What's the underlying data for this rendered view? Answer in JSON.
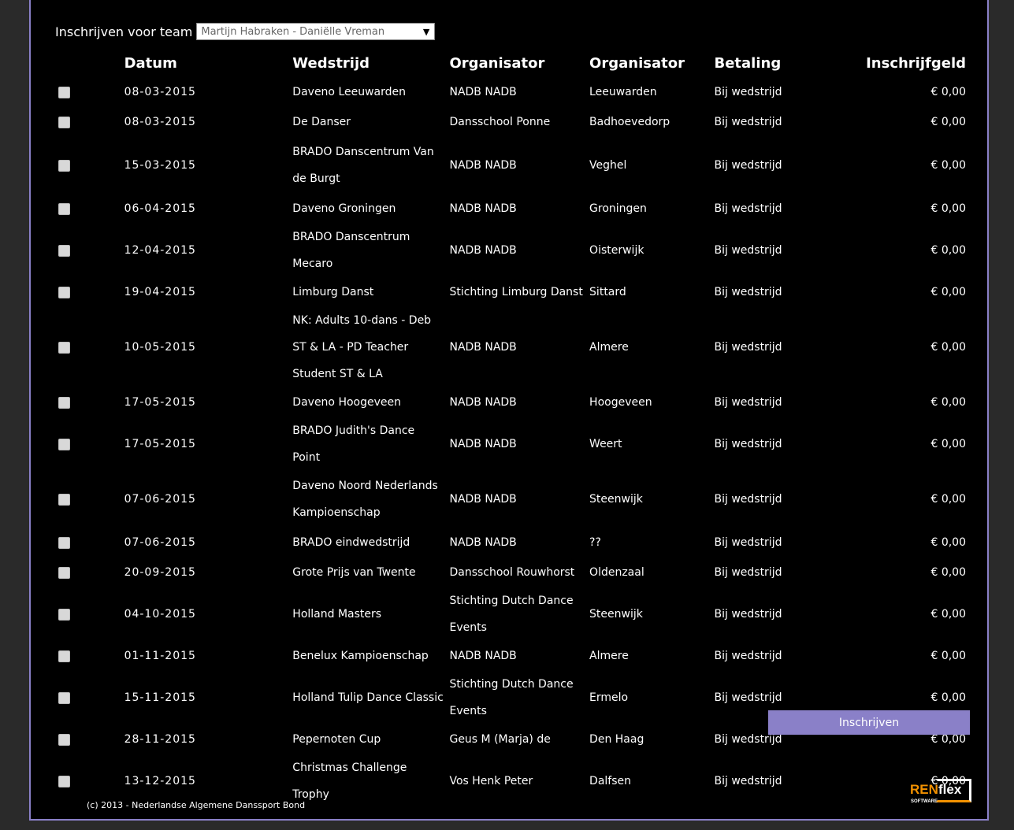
{
  "team": {
    "label": "Inschrijven voor team",
    "selected": "Martijn Habraken - Daniëlle Vreman",
    "arrow": "▼"
  },
  "table": {
    "headers": {
      "datum": "Datum",
      "wedstrijd": "Wedstrijd",
      "organisator": "Organisator",
      "plaats": "Organisator",
      "betaling": "Betaling",
      "inschrijfgeld": "Inschrijfgeld"
    },
    "rows": [
      {
        "date": "08-03-2015",
        "event": "Daveno Leeuwarden",
        "organizer": "NADB NADB",
        "city": "Leeuwarden",
        "payment": "Bij wedstrijd",
        "fee": "€ 0,00"
      },
      {
        "date": "08-03-2015",
        "event": "De Danser",
        "organizer": "Dansschool Ponne",
        "city": "Badhoevedorp",
        "payment": "Bij wedstrijd",
        "fee": "€ 0,00"
      },
      {
        "date": "15-03-2015",
        "event": "BRADO Danscentrum Van de Burgt",
        "organizer": "NADB NADB",
        "city": "Veghel",
        "payment": "Bij wedstrijd",
        "fee": "€ 0,00"
      },
      {
        "date": "06-04-2015",
        "event": "Daveno Groningen",
        "organizer": "NADB NADB",
        "city": "Groningen",
        "payment": "Bij wedstrijd",
        "fee": "€ 0,00"
      },
      {
        "date": "12-04-2015",
        "event": "BRADO Danscentrum Mecaro",
        "organizer": "NADB NADB",
        "city": "Oisterwijk",
        "payment": "Bij wedstrijd",
        "fee": "€ 0,00"
      },
      {
        "date": "19-04-2015",
        "event": "Limburg Danst",
        "organizer": "Stichting Limburg Danst",
        "city": "Sittard",
        "payment": "Bij wedstrijd",
        "fee": "€ 0,00"
      },
      {
        "date": "10-05-2015",
        "event": "NK: Adults 10-dans - Deb ST & LA - PD Teacher Student ST & LA",
        "organizer": "NADB NADB",
        "city": "Almere",
        "payment": "Bij wedstrijd",
        "fee": "€ 0,00"
      },
      {
        "date": "17-05-2015",
        "event": "Daveno Hoogeveen",
        "organizer": "NADB NADB",
        "city": "Hoogeveen",
        "payment": "Bij wedstrijd",
        "fee": "€ 0,00"
      },
      {
        "date": "17-05-2015",
        "event": "BRADO Judith's Dance Point",
        "organizer": "NADB NADB",
        "city": "Weert",
        "payment": "Bij wedstrijd",
        "fee": "€ 0,00"
      },
      {
        "date": "07-06-2015",
        "event": "Daveno Noord Nederlands Kampioenschap",
        "organizer": "NADB NADB",
        "city": "Steenwijk",
        "payment": "Bij wedstrijd",
        "fee": "€ 0,00"
      },
      {
        "date": "07-06-2015",
        "event": "BRADO eindwedstrijd",
        "organizer": "NADB NADB",
        "city": "??",
        "payment": "Bij wedstrijd",
        "fee": "€ 0,00"
      },
      {
        "date": "20-09-2015",
        "event": "Grote Prijs van Twente",
        "organizer": "Dansschool Rouwhorst",
        "city": "Oldenzaal",
        "payment": "Bij wedstrijd",
        "fee": "€ 0,00"
      },
      {
        "date": "04-10-2015",
        "event": "Holland Masters",
        "organizer": "Stichting Dutch Dance Events",
        "city": "Steenwijk",
        "payment": "Bij wedstrijd",
        "fee": "€ 0,00"
      },
      {
        "date": "01-11-2015",
        "event": "Benelux Kampioenschap",
        "organizer": "NADB NADB",
        "city": "Almere",
        "payment": "Bij wedstrijd",
        "fee": "€ 0,00"
      },
      {
        "date": "15-11-2015",
        "event": "Holland Tulip Dance Classic",
        "organizer": "Stichting Dutch Dance Events",
        "city": "Ermelo",
        "payment": "Bij wedstrijd",
        "fee": "€ 0,00"
      },
      {
        "date": "28-11-2015",
        "event": "Pepernoten Cup",
        "organizer": "Geus M (Marja) de",
        "city": "Den Haag",
        "payment": "Bij wedstrijd",
        "fee": "€ 0,00"
      },
      {
        "date": "13-12-2015",
        "event": "Christmas Challenge Trophy",
        "organizer": "Vos Henk Peter",
        "city": "Dalfsen",
        "payment": "Bij wedstrijd",
        "fee": "€ 0,00"
      }
    ]
  },
  "submit_label": "Inschrijven",
  "footer": "(c) 2013 - Nederlandse Algemene Danssport Bond",
  "logo": {
    "ren": "REN",
    "flex": "flex",
    "software": "SOFTWARE"
  },
  "colors": {
    "accent": "#8a80c8",
    "logo_orange": "#f29100",
    "background": "#000000"
  }
}
